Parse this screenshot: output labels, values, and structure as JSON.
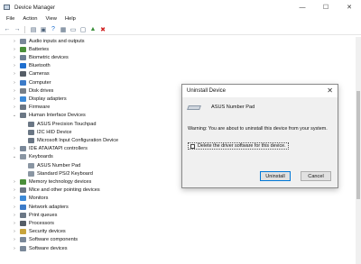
{
  "window": {
    "title": "Device Manager",
    "minimize": "—",
    "maximize": "☐",
    "close": "✕"
  },
  "menu": [
    "File",
    "Action",
    "View",
    "Help"
  ],
  "tree": [
    {
      "label": "Audio inputs and outputs",
      "level": 0,
      "expanded": false,
      "color": "#7a8899"
    },
    {
      "label": "Batteries",
      "level": 0,
      "expanded": false,
      "color": "#4a8f3a"
    },
    {
      "label": "Biometric devices",
      "level": 0,
      "expanded": false,
      "color": "#6d7f94"
    },
    {
      "label": "Bluetooth",
      "level": 0,
      "expanded": false,
      "color": "#1f6fcf"
    },
    {
      "label": "Cameras",
      "level": 0,
      "expanded": false,
      "color": "#555d66"
    },
    {
      "label": "Computer",
      "level": 0,
      "expanded": false,
      "color": "#3c7bc8"
    },
    {
      "label": "Disk drives",
      "level": 0,
      "expanded": false,
      "color": "#777f88"
    },
    {
      "label": "Display adapters",
      "level": 0,
      "expanded": false,
      "color": "#3c8ad8"
    },
    {
      "label": "Firmware",
      "level": 0,
      "expanded": false,
      "color": "#6b7785"
    },
    {
      "label": "Human Interface Devices",
      "level": 0,
      "expanded": true,
      "color": "#6b7785"
    },
    {
      "label": "ASUS Precision Touchpad",
      "level": 1,
      "color": "#6b7785"
    },
    {
      "label": "I2C HID Device",
      "level": 1,
      "color": "#6b7785"
    },
    {
      "label": "Microsoft Input Configuration Device",
      "level": 1,
      "color": "#6b7785"
    },
    {
      "label": "IDE ATA/ATAPI controllers",
      "level": 0,
      "expanded": false,
      "color": "#7a8899"
    },
    {
      "label": "Keyboards",
      "level": 0,
      "expanded": true,
      "color": "#8a96a3"
    },
    {
      "label": "ASUS Number Pad",
      "level": 1,
      "color": "#8a96a3"
    },
    {
      "label": "Standard PS/2 Keyboard",
      "level": 1,
      "color": "#8a96a3"
    },
    {
      "label": "Memory technology devices",
      "level": 0,
      "expanded": false,
      "color": "#4a8f3a"
    },
    {
      "label": "Mice and other pointing devices",
      "level": 0,
      "expanded": false,
      "color": "#6b7785"
    },
    {
      "label": "Monitors",
      "level": 0,
      "expanded": false,
      "color": "#3c8ad8"
    },
    {
      "label": "Network adapters",
      "level": 0,
      "expanded": false,
      "color": "#3c7bc8"
    },
    {
      "label": "Print queues",
      "level": 0,
      "expanded": false,
      "color": "#6b7785"
    },
    {
      "label": "Processors",
      "level": 0,
      "expanded": false,
      "color": "#555d66"
    },
    {
      "label": "Security devices",
      "level": 0,
      "expanded": false,
      "color": "#c8a43c"
    },
    {
      "label": "Software components",
      "level": 0,
      "expanded": false,
      "color": "#7a8899"
    },
    {
      "label": "Software devices",
      "level": 0,
      "expanded": false,
      "color": "#7a8899"
    }
  ],
  "dialog": {
    "title": "Uninstall Device",
    "close": "✕",
    "device_name": "ASUS Number Pad",
    "warning": "Warning: You are about to uninstall this device from your system.",
    "checkbox_label": "Delete the driver software for this device.",
    "checkbox_checked": false,
    "uninstall_label": "Uninstall",
    "cancel_label": "Cancel"
  }
}
